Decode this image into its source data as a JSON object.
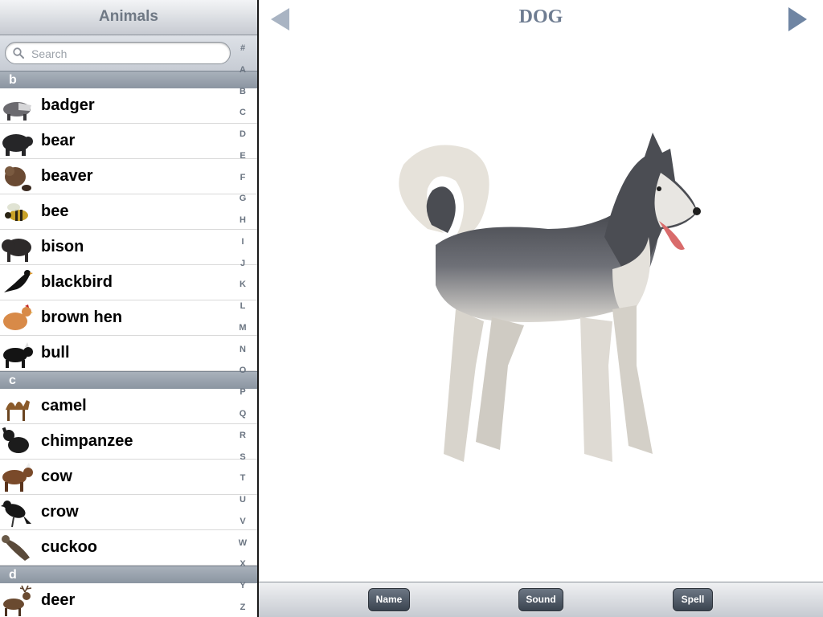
{
  "sidebar": {
    "title": "Animals",
    "search_placeholder": "Search",
    "sections": [
      {
        "letter": "b",
        "items": [
          "badger",
          "bear",
          "beaver",
          "bee",
          "bison",
          "blackbird",
          "brown hen",
          "bull"
        ]
      },
      {
        "letter": "c",
        "items": [
          "camel",
          "chimpanzee",
          "cow",
          "crow",
          "cuckoo"
        ]
      },
      {
        "letter": "d",
        "items": [
          "deer"
        ]
      }
    ],
    "index": [
      "#",
      "A",
      "B",
      "C",
      "D",
      "E",
      "F",
      "G",
      "H",
      "I",
      "J",
      "K",
      "L",
      "M",
      "N",
      "O",
      "P",
      "Q",
      "R",
      "S",
      "T",
      "U",
      "V",
      "W",
      "X",
      "Y",
      "Z"
    ]
  },
  "main": {
    "title": "DOG",
    "image_icon": "husky-dog-illustration"
  },
  "toolbar": {
    "name_label": "Name",
    "sound_label": "Sound",
    "spell_label": "Spell"
  },
  "colors": {
    "accent": "#6e7c91",
    "section_header": "#9aa3ae"
  }
}
